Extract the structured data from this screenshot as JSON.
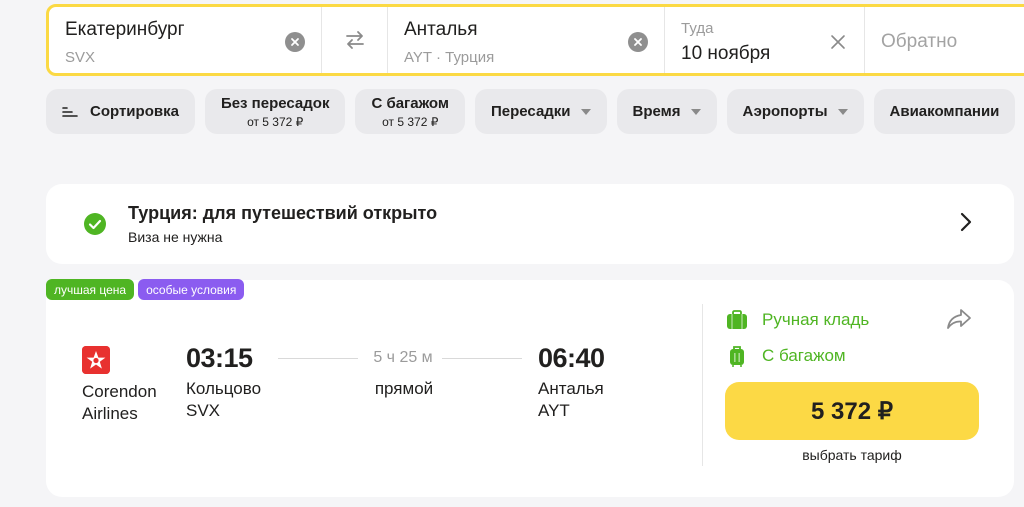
{
  "search": {
    "from": {
      "city": "Екатеринбург",
      "code": "SVX"
    },
    "to": {
      "city": "Анталья",
      "code": "AYT · Турция"
    },
    "date": {
      "label": "Туда",
      "value": "10 ноября"
    },
    "return": {
      "placeholder": "Обратно"
    },
    "icons": {
      "clear": "clear-circle-icon",
      "swap": "swap-arrows-icon",
      "close": "close-icon"
    },
    "accent_color": "#fbd944"
  },
  "filters": {
    "sort": "Сортировка",
    "direct": {
      "label": "Без пересадок",
      "sub": "от 5 372 ₽"
    },
    "baggage": {
      "label": "С багажом",
      "sub": "от 5 372 ₽"
    },
    "transfers": "Пересадки",
    "time": "Время",
    "airports": "Аэропорты",
    "airlines": "Авиакомпании"
  },
  "info": {
    "title": "Турция: для путешествий открыто",
    "subtitle": "Виза не нужна",
    "icon": "check-circle-icon"
  },
  "badges": {
    "best_price": "лучшая цена",
    "special": "особые условия",
    "colors": {
      "best_price": "#4fb523",
      "special": "#8b5cf0"
    }
  },
  "flight": {
    "airline": "Corendon Airlines",
    "departure": {
      "time": "03:15",
      "airport": "Кольцово",
      "code": "SVX"
    },
    "duration": "5 ч 25 м",
    "type": "прямой",
    "arrival": {
      "time": "06:40",
      "city": "Анталья",
      "code": "AYT"
    },
    "hand_luggage": "Ручная кладь",
    "with_baggage": "С багажом",
    "price": "5 372 ₽",
    "tariff_label": "выбрать тариф",
    "price_color": "#fcd945",
    "baggage_color": "#4fb523"
  }
}
